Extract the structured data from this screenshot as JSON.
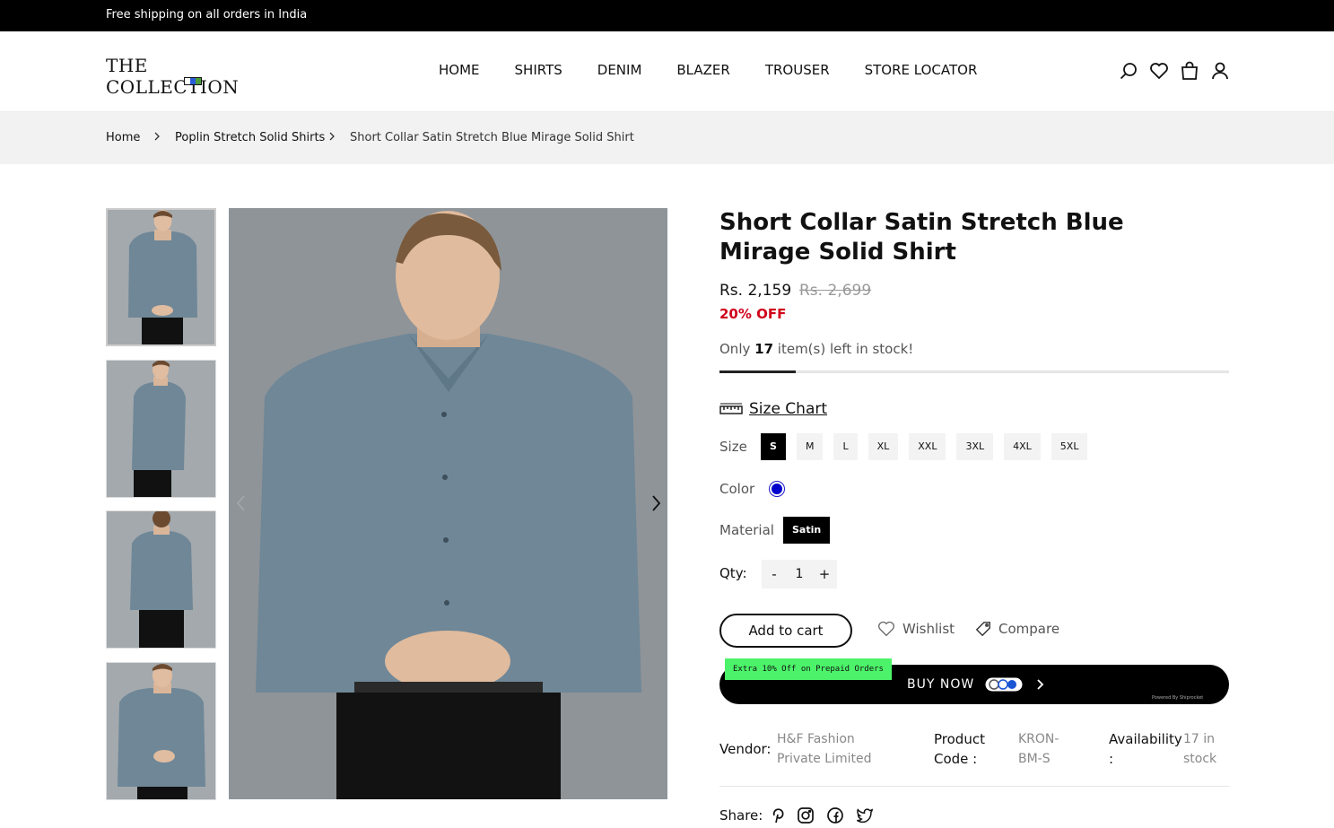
{
  "announcement": "Free shipping on all orders in India",
  "brand": {
    "name": "THE COLLECTION"
  },
  "nav": [
    "HOME",
    "SHIRTS",
    "DENIM",
    "BLAZER",
    "TROUSER",
    "STORE LOCATOR"
  ],
  "header_icons": [
    "search-icon",
    "heart-icon",
    "bag-icon",
    "user-icon"
  ],
  "breadcrumb": [
    "Home",
    "Poplin Stretch Solid Shirts",
    "Short Collar Satin Stretch Blue Mirage Solid Shirt"
  ],
  "product": {
    "title": "Short Collar Satin Stretch Blue Mirage Solid Shirt",
    "price": "Rs. 2,159",
    "compare_price": "Rs. 2,699",
    "discount": "20% OFF",
    "stock_prefix": "Only",
    "stock_count": "17",
    "stock_suffix": "item(s) left in stock!",
    "stock_bar_fraction": 0.15,
    "size_chart_label": "Size Chart",
    "size_label": "Size",
    "sizes": [
      "S",
      "M",
      "L",
      "XL",
      "XXL",
      "3XL",
      "4XL",
      "5XL"
    ],
    "selected_size": "S",
    "color_label": "Color",
    "color_swatch": "#0000cc",
    "material_label": "Material",
    "material": "Satin",
    "qty_label": "Qty:",
    "qty_minus": "-",
    "qty_value": "1",
    "qty_plus": "+",
    "add_to_cart": "Add to cart",
    "wishlist": "Wishlist",
    "compare": "Compare",
    "buy_now": "BUY NOW",
    "promo": "Extra 10% Off on Prepaid Orders",
    "powered_by": "Powered By Shiprocket",
    "vendor_label": "Vendor:",
    "vendor": "H&F Fashion Private Limited",
    "code_label": "Product Code :",
    "code": "KRON-BM-S",
    "availability_label": "Availability :",
    "availability": "17 in stock",
    "share_label": "Share:",
    "share_icons": [
      "pinterest-icon",
      "instagram-icon",
      "facebook-icon",
      "twitter-icon"
    ]
  },
  "colors": {
    "shirt": "#6f8797",
    "background": "#8f9498",
    "accent": "#d0021b",
    "promo": "#4cf36a"
  }
}
